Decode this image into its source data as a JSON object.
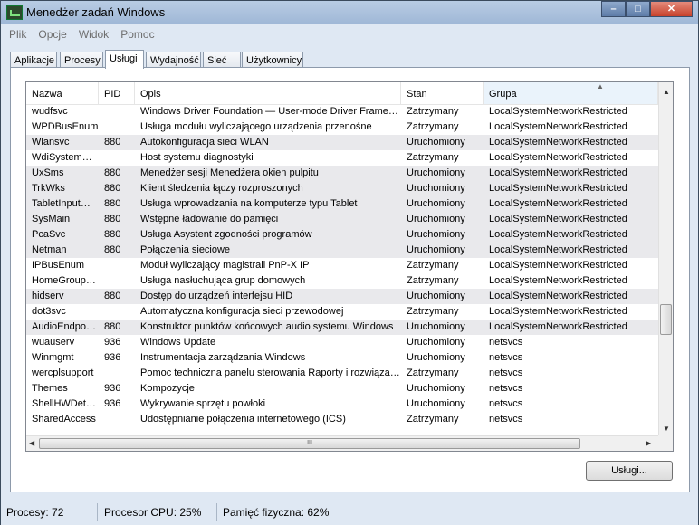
{
  "window": {
    "title": "Menedżer zadań Windows"
  },
  "controls": {
    "minimize": "–",
    "maximize": "□",
    "close": "✕"
  },
  "menu": [
    "Plik",
    "Opcje",
    "Widok",
    "Pomoc"
  ],
  "tabs": [
    "Aplikacje",
    "Procesy",
    "Usługi",
    "Wydajność",
    "Sieć",
    "Użytkownicy"
  ],
  "active_tab": "Usługi",
  "columns": [
    "Nazwa",
    "PID",
    "Opis",
    "Stan",
    "Grupa"
  ],
  "sorted_column": "Grupa",
  "services": [
    [
      "wudfsvc",
      "",
      "Windows Driver Foundation — User-mode Driver Frame…",
      "Zatrzymany",
      "LocalSystemNetworkRestricted"
    ],
    [
      "WPDBusEnum",
      "",
      "Usługa modułu wyliczającego urządzenia przenośne",
      "Zatrzymany",
      "LocalSystemNetworkRestricted"
    ],
    [
      "Wlansvc",
      "880",
      "Autokonfiguracja sieci WLAN",
      "Uruchomiony",
      "LocalSystemNetworkRestricted"
    ],
    [
      "WdiSystem…",
      "",
      "Host systemu diagnostyki",
      "Zatrzymany",
      "LocalSystemNetworkRestricted"
    ],
    [
      "UxSms",
      "880",
      "Menedżer sesji Menedżera okien pulpitu",
      "Uruchomiony",
      "LocalSystemNetworkRestricted"
    ],
    [
      "TrkWks",
      "880",
      "Klient śledzenia łączy rozproszonych",
      "Uruchomiony",
      "LocalSystemNetworkRestricted"
    ],
    [
      "TabletInput…",
      "880",
      "Usługa wprowadzania na komputerze typu Tablet",
      "Uruchomiony",
      "LocalSystemNetworkRestricted"
    ],
    [
      "SysMain",
      "880",
      "Wstępne ładowanie do pamięci",
      "Uruchomiony",
      "LocalSystemNetworkRestricted"
    ],
    [
      "PcaSvc",
      "880",
      "Usługa Asystent zgodności programów",
      "Uruchomiony",
      "LocalSystemNetworkRestricted"
    ],
    [
      "Netman",
      "880",
      "Połączenia sieciowe",
      "Uruchomiony",
      "LocalSystemNetworkRestricted"
    ],
    [
      "IPBusEnum",
      "",
      "Moduł wyliczający magistrali PnP-X IP",
      "Zatrzymany",
      "LocalSystemNetworkRestricted"
    ],
    [
      "HomeGroup…",
      "",
      "Usługa nasłuchująca grup domowych",
      "Zatrzymany",
      "LocalSystemNetworkRestricted"
    ],
    [
      "hidserv",
      "880",
      "Dostęp do urządzeń interfejsu HID",
      "Uruchomiony",
      "LocalSystemNetworkRestricted"
    ],
    [
      "dot3svc",
      "",
      "Automatyczna konfiguracja sieci przewodowej",
      "Zatrzymany",
      "LocalSystemNetworkRestricted"
    ],
    [
      "AudioEndpo…",
      "880",
      "Konstruktor punktów końcowych audio systemu Windows",
      "Uruchomiony",
      "LocalSystemNetworkRestricted"
    ],
    [
      "wuauserv",
      "936",
      "Windows Update",
      "Uruchomiony",
      "netsvcs"
    ],
    [
      "Winmgmt",
      "936",
      "Instrumentacja zarządzania Windows",
      "Uruchomiony",
      "netsvcs"
    ],
    [
      "wercplsupport",
      "",
      "Pomoc techniczna panelu sterowania Raporty i rozwiąza…",
      "Zatrzymany",
      "netsvcs"
    ],
    [
      "Themes",
      "936",
      "Kompozycje",
      "Uruchomiony",
      "netsvcs"
    ],
    [
      "ShellHWDet…",
      "936",
      "Wykrywanie sprzętu powłoki",
      "Uruchomiony",
      "netsvcs"
    ],
    [
      "SharedAccess",
      "",
      "Udostępnianie połączenia internetowego (ICS)",
      "Zatrzymany",
      "netsvcs"
    ]
  ],
  "services_button": "Usługi...",
  "scrollbar_grip": "III",
  "status": {
    "processes": "Procesy: 72",
    "cpu": "Procesor CPU: 25%",
    "memory": "Pamięć fizyczna: 62%"
  }
}
